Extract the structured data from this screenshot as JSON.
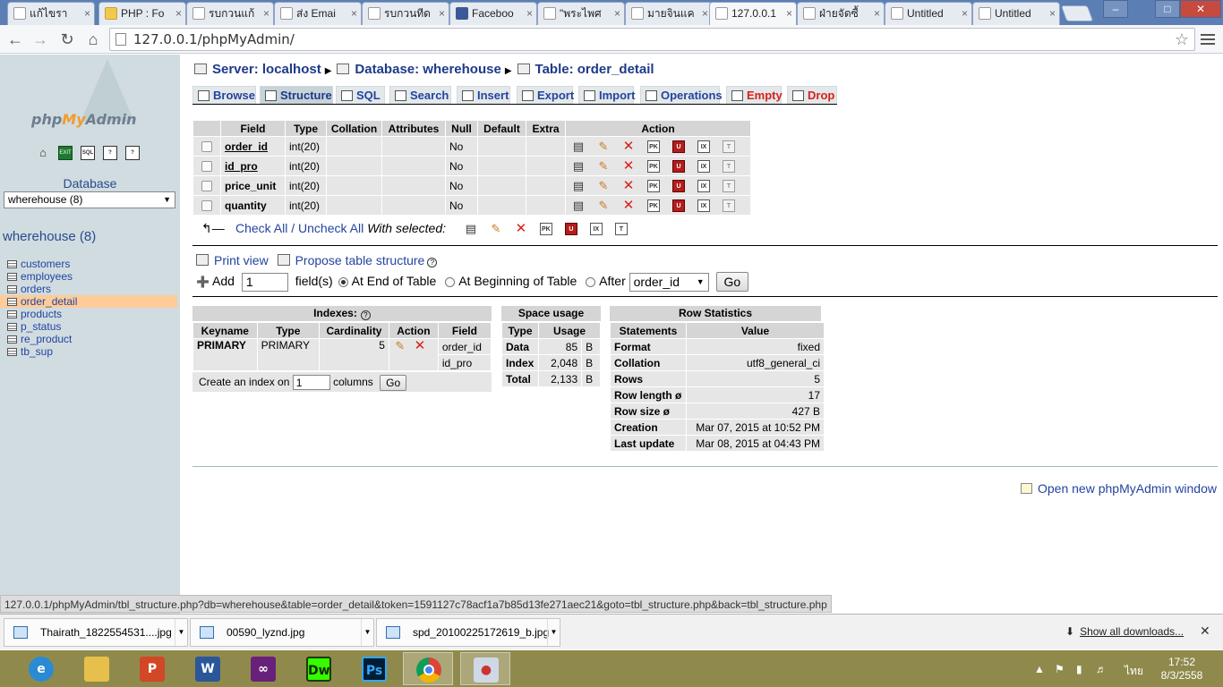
{
  "browser": {
    "tabs": [
      {
        "label": "แก้ไขรา",
        "icon": "page-icon"
      },
      {
        "label": "PHP : Fo",
        "icon": "lock-icon"
      },
      {
        "label": "รบกวนแก้",
        "icon": "page-icon"
      },
      {
        "label": "ส่ง Emai",
        "icon": "page-icon"
      },
      {
        "label": "รบกวนทีด",
        "icon": "page-icon"
      },
      {
        "label": "Faceboo",
        "icon": "facebook-icon"
      },
      {
        "label": "\"พระไพศ",
        "icon": "page-icon"
      },
      {
        "label": "มายจินแค",
        "icon": "page-icon"
      },
      {
        "label": "127.0.0.1",
        "icon": "pma-icon"
      },
      {
        "label": "ฝ่ายจัดซื้",
        "icon": "page-icon"
      },
      {
        "label": "Untitled",
        "icon": "page-icon"
      },
      {
        "label": "Untitled",
        "icon": "page-icon"
      }
    ],
    "active_tab": 8,
    "url": "127.0.0.1/phpMyAdmin/"
  },
  "nav": {
    "logo_php": "php",
    "logo_my": "My",
    "logo_admin": "Admin",
    "db_label": "Database",
    "db_selected": "wherehouse (8)",
    "db_title": "wherehouse (8)",
    "tables": [
      "customers",
      "employees",
      "orders",
      "order_detail",
      "products",
      "p_status",
      "re_product",
      "tb_sup"
    ],
    "current_table": "order_detail"
  },
  "breadcrumb": {
    "server": "Server: localhost",
    "database": "Database: wherehouse",
    "table": "Table: order_detail"
  },
  "menu": {
    "browse": "Browse",
    "structure": "Structure",
    "sql": "SQL",
    "search": "Search",
    "insert": "Insert",
    "export": "Export",
    "import": "Import",
    "operations": "Operations",
    "empty": "Empty",
    "drop": "Drop"
  },
  "structure": {
    "headers": [
      "Field",
      "Type",
      "Collation",
      "Attributes",
      "Null",
      "Default",
      "Extra",
      "Action"
    ],
    "rows": [
      {
        "field": "order_id",
        "type": "int(20)",
        "null": "No",
        "primary": true
      },
      {
        "field": "id_pro",
        "type": "int(20)",
        "null": "No",
        "primary": true
      },
      {
        "field": "price_unit",
        "type": "int(20)",
        "null": "No",
        "primary": false
      },
      {
        "field": "quantity",
        "type": "int(20)",
        "null": "No",
        "primary": false
      }
    ],
    "check_all": "Check All",
    "slash": " / ",
    "uncheck_all": "Uncheck All",
    "with_selected": "With selected:"
  },
  "tools": {
    "print_view": "Print view",
    "propose": "Propose table structure",
    "add": "Add",
    "add_value": "1",
    "fields": "field(s)",
    "at_end": "At End of Table",
    "at_begin": "At Beginning of Table",
    "after": "After",
    "after_field": "order_id",
    "go": "Go"
  },
  "indexes": {
    "title": "Indexes:",
    "headers": [
      "Keyname",
      "Type",
      "Cardinality",
      "Action",
      "Field"
    ],
    "keyname": "PRIMARY",
    "type": "PRIMARY",
    "cardinality": "5",
    "fields": [
      "order_id",
      "id_pro"
    ],
    "create_label": "Create an index on",
    "create_value": "1",
    "columns_label": "columns",
    "go": "Go"
  },
  "space": {
    "title": "Space usage",
    "headers": [
      "Type",
      "Usage"
    ],
    "rows": [
      {
        "type": "Data",
        "usage": "85",
        "unit": "B"
      },
      {
        "type": "Index",
        "usage": "2,048",
        "unit": "B"
      },
      {
        "type": "Total",
        "usage": "2,133",
        "unit": "B"
      }
    ]
  },
  "stats": {
    "title": "Row Statistics",
    "headers": [
      "Statements",
      "Value"
    ],
    "rows": [
      {
        "k": "Format",
        "v": "fixed"
      },
      {
        "k": "Collation",
        "v": "utf8_general_ci"
      },
      {
        "k": "Rows",
        "v": "5"
      },
      {
        "k": "Row length ø",
        "v": "17"
      },
      {
        "k": "Row size ø",
        "v": "427 B"
      },
      {
        "k": "Creation",
        "v": "Mar 07, 2015 at 10:52 PM"
      },
      {
        "k": "Last update",
        "v": "Mar 08, 2015 at 04:43 PM"
      }
    ]
  },
  "open_window": "Open new phpMyAdmin window",
  "status_url": "127.0.0.1/phpMyAdmin/tbl_structure.php?db=wherehouse&table=order_detail&token=1591127c78acf1a7b85d13fe271aec21&goto=tbl_structure.php&back=tbl_structure.php",
  "downloads": {
    "items": [
      "Thairath_1822554531....jpg",
      "00590_lyznd.jpg",
      "spd_20100225172619_b.jpg"
    ],
    "show_all": "Show all downloads..."
  },
  "taskbar": {
    "apps": [
      "ie-icon",
      "explorer-icon",
      "powerpoint-icon",
      "word-icon",
      "visual-studio-icon",
      "dreamweaver-icon",
      "photoshop-icon",
      "chrome-icon",
      "paint-icon"
    ],
    "lang": "ไทย",
    "time": "17:52",
    "date": "8/3/2558"
  }
}
